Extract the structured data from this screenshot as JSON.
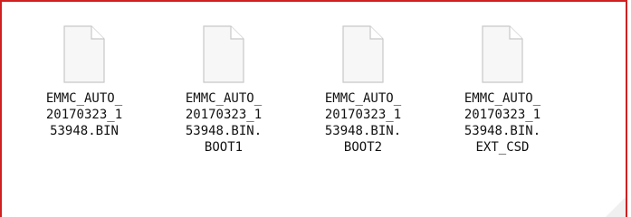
{
  "folder_view": {
    "files": [
      {
        "name": "EMMC_AUTO_\n20170323_1\n53948.BIN",
        "icon": "generic-file-icon"
      },
      {
        "name": "EMMC_AUTO_\n20170323_1\n53948.BIN.\nBOOT1",
        "icon": "generic-file-icon"
      },
      {
        "name": "EMMC_AUTO_\n20170323_1\n53948.BIN.\nBOOT2",
        "icon": "generic-file-icon"
      },
      {
        "name": "EMMC_AUTO_\n20170323_1\n53948.BIN.\nEXT_CSD",
        "icon": "generic-file-icon"
      }
    ]
  },
  "colors": {
    "frame_border": "#d02020",
    "icon_fill": "#f7f7f7",
    "icon_stroke": "#c8c8c8",
    "text": "#111111"
  }
}
